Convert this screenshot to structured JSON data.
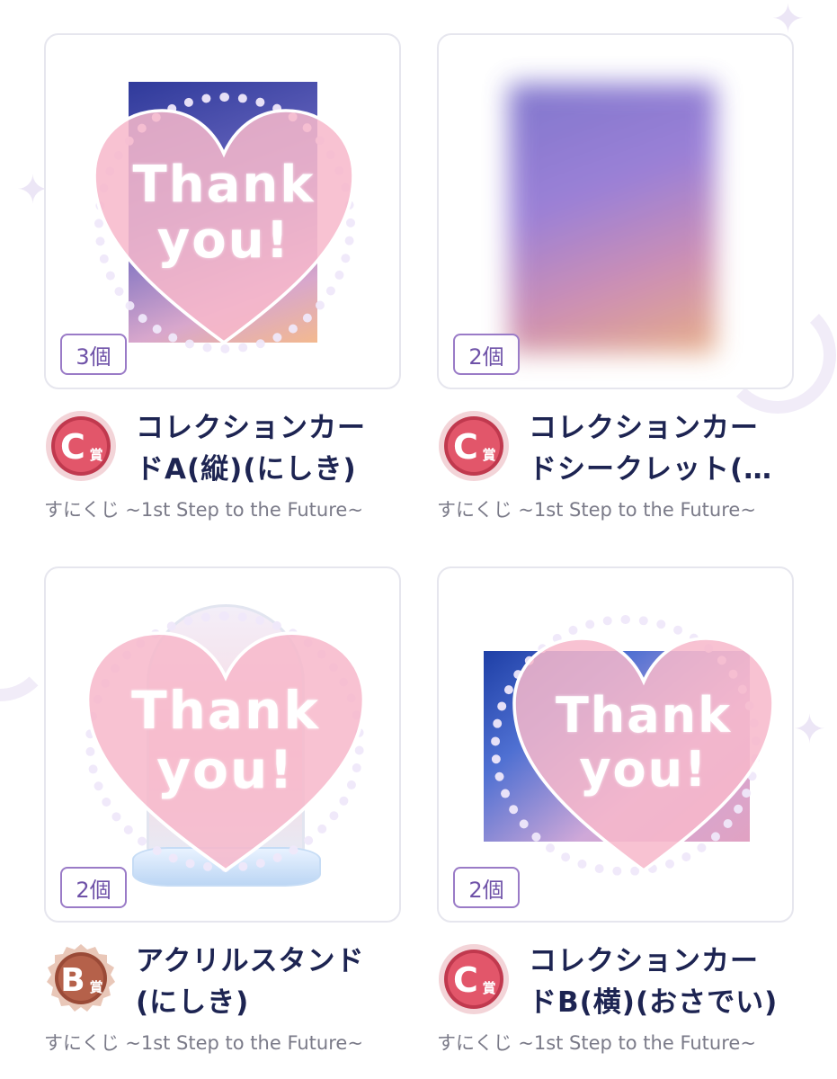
{
  "items": [
    {
      "quantity": "3個",
      "overlay_line1": "Thank",
      "overlay_line2": "you!",
      "prize_letter": "C",
      "prize_suffix": "賞",
      "title_line1": "コレクションカー",
      "title_line2": "ドA(縦)(にしき)",
      "series": "すにくじ ~1st Step to the Future~"
    },
    {
      "quantity": "2個",
      "prize_letter": "C",
      "prize_suffix": "賞",
      "title_line1": "コレクションカー",
      "title_line2": "ドシークレット(…",
      "series": "すにくじ ~1st Step to the Future~"
    },
    {
      "quantity": "2個",
      "overlay_line1": "Thank",
      "overlay_line2": "you!",
      "prize_letter": "B",
      "prize_suffix": "賞",
      "title_line1": "アクリルスタンド",
      "title_line2": "(にしき)",
      "series": "すにくじ ~1st Step to the Future~"
    },
    {
      "quantity": "2個",
      "overlay_line1": "Thank",
      "overlay_line2": "you!",
      "prize_letter": "C",
      "prize_suffix": "賞",
      "title_line1": "コレクションカー",
      "title_line2": "ドB(横)(おさでい)",
      "series": "すにくじ ~1st Step to the Future~"
    }
  ],
  "icons": {
    "prize_badge_c": "c-prize-badge-icon",
    "prize_badge_b": "b-prize-badge-icon",
    "sticker": "thank-you-heart-sticker"
  },
  "colors": {
    "title": "#1d2452",
    "quantity_accent": "#6f52a8",
    "heart_pink": "#f7b8cb",
    "badge_c": "#c0394e",
    "badge_b": "#9a4a37",
    "series_text": "#7a7a88"
  }
}
